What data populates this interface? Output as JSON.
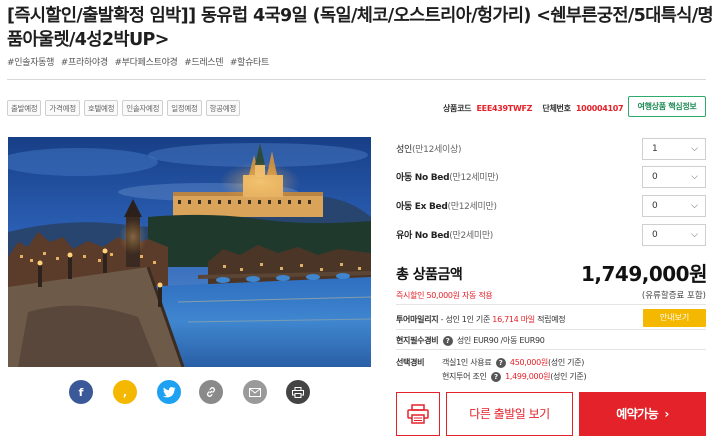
{
  "product": {
    "title": "[즉시할인/출발확정 임박]] 동유럽 4국9일 (독일/체코/오스트리아/헝가리) <쉔부른궁전/5대특식/명품아울렛/4성2박UP>",
    "hashtags": [
      "#인솔자동행",
      "#프라하야경",
      "#부다페스트야경",
      "#드레스덴",
      "#할슈타트"
    ]
  },
  "subtabs": [
    "출발예정",
    "가격예정",
    "호텔예정",
    "인솔자예정",
    "일정예정",
    "항공예정"
  ],
  "codes": {
    "product_code_label": "상품코드",
    "product_code": "EEE439TWFZ",
    "group_no_label": "단체번호",
    "group_no": "100004107"
  },
  "reserve_info_button": "여행상품 핵심정보",
  "colors": {
    "accent_red": "#e3222a",
    "green": "#2eaa6b",
    "yellow": "#f5b800",
    "facebook": "#3b5998",
    "kakaostory": "#f5b800",
    "twitter": "#1da1f2",
    "link": "#8a8a8a",
    "email": "#9a9a9a",
    "print": "#444444"
  },
  "pax": [
    {
      "label": "성인",
      "sub": "(만12세이상)",
      "value": "1"
    },
    {
      "label": "아동 No Bed",
      "sub": "(만12세미만)",
      "value": "0"
    },
    {
      "label": "아동 Ex Bed",
      "sub": "(만12세미만)",
      "value": "0"
    },
    {
      "label": "유아 No Bed",
      "sub": "(만2세미만)",
      "value": "0"
    }
  ],
  "total": {
    "label": "총 상품금액",
    "price": "1,749,000원",
    "discount_note": "즉시할인 50,000원 자동 적용",
    "fuel_note": "(유류할증료 포함)"
  },
  "mileage": {
    "label": "투어마일리지",
    "text_pre": " - 성인 1인 기준 ",
    "amount": "16,714 마일",
    "text_post": " 적립예정",
    "button": "안내보기"
  },
  "local_fee": {
    "label": "현지필수경비",
    "value": "성인 EUR90 /아동 EUR90"
  },
  "options": {
    "label": "선택경비",
    "single_label": "객실1인 사용료",
    "single_value": "450,000원",
    "single_note": "(성인 기준)",
    "tour_label": "현지투어 조인",
    "tour_value": "1,499,000원",
    "tour_note": "(성인 기준)"
  },
  "buttons": {
    "other_dates": "다른 출발일 보기",
    "book": "예약가능"
  },
  "share_icons": [
    "facebook-icon",
    "kakaostory-icon",
    "twitter-icon",
    "link-icon",
    "email-icon",
    "print-icon"
  ]
}
